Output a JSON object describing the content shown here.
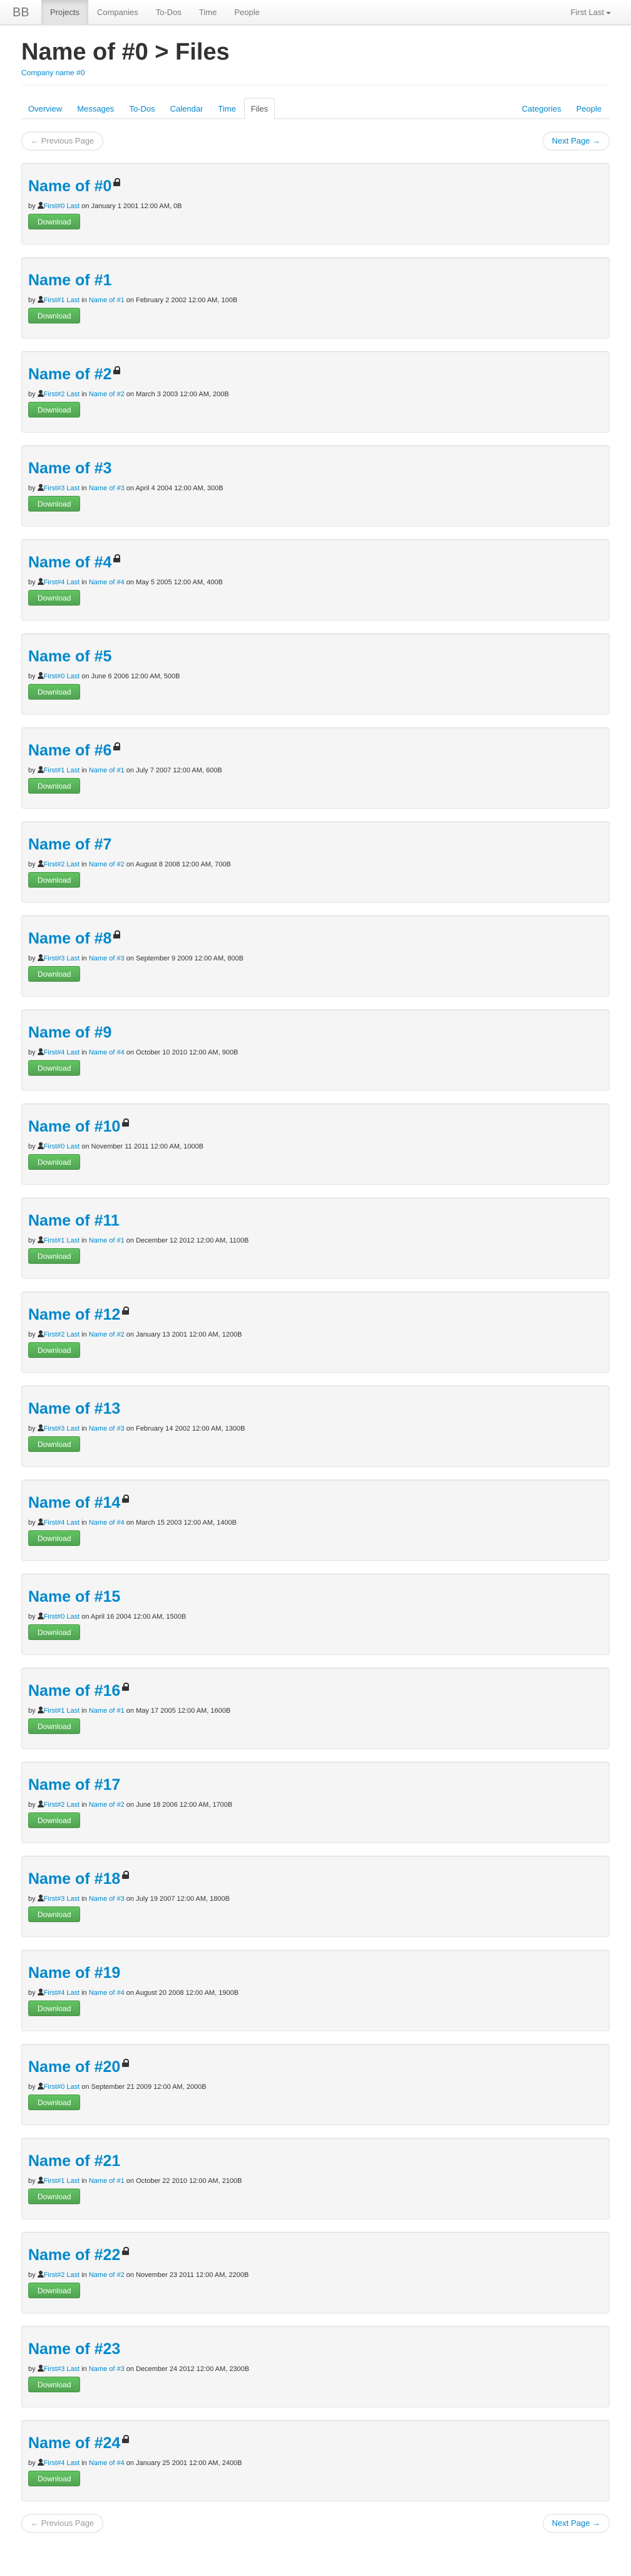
{
  "navbar": {
    "brand": "BB",
    "items": [
      {
        "label": "Projects",
        "active": true
      },
      {
        "label": "Companies",
        "active": false
      },
      {
        "label": "To-Dos",
        "active": false
      },
      {
        "label": "Time",
        "active": false
      },
      {
        "label": "People",
        "active": false
      }
    ],
    "user": "First Last"
  },
  "header": {
    "title": "Name of #0 > Files",
    "company": "Company name #0"
  },
  "tabs": {
    "left": [
      {
        "label": "Overview",
        "active": false
      },
      {
        "label": "Messages",
        "active": false
      },
      {
        "label": "To-Dos",
        "active": false
      },
      {
        "label": "Calendar",
        "active": false
      },
      {
        "label": "Time",
        "active": false
      },
      {
        "label": "Files",
        "active": true
      }
    ],
    "right": [
      {
        "label": "Categories"
      },
      {
        "label": "People"
      }
    ]
  },
  "pager": {
    "prev": "← Previous Page",
    "next": "Next Page →"
  },
  "strings": {
    "by": "by",
    "in": "in",
    "on": "on",
    "download": "Download"
  },
  "files": [
    {
      "name": "Name of #0",
      "locked": true,
      "author": "First#0 Last",
      "project": "",
      "date": "January 1 2001 12:00 AM",
      "size": "0B"
    },
    {
      "name": "Name of #1",
      "locked": false,
      "author": "First#1 Last",
      "project": "Name of #1",
      "date": "February 2 2002 12:00 AM",
      "size": "100B"
    },
    {
      "name": "Name of #2",
      "locked": true,
      "author": "First#2 Last",
      "project": "Name of #2",
      "date": "March 3 2003 12:00 AM",
      "size": "200B"
    },
    {
      "name": "Name of #3",
      "locked": false,
      "author": "First#3 Last",
      "project": "Name of #3",
      "date": "April 4 2004 12:00 AM",
      "size": "300B"
    },
    {
      "name": "Name of #4",
      "locked": true,
      "author": "First#4 Last",
      "project": "Name of #4",
      "date": "May 5 2005 12:00 AM",
      "size": "400B"
    },
    {
      "name": "Name of #5",
      "locked": false,
      "author": "First#0 Last",
      "project": "",
      "date": "June 6 2006 12:00 AM",
      "size": "500B"
    },
    {
      "name": "Name of #6",
      "locked": true,
      "author": "First#1 Last",
      "project": "Name of #1",
      "date": "July 7 2007 12:00 AM",
      "size": "600B"
    },
    {
      "name": "Name of #7",
      "locked": false,
      "author": "First#2 Last",
      "project": "Name of #2",
      "date": "August 8 2008 12:00 AM",
      "size": "700B"
    },
    {
      "name": "Name of #8",
      "locked": true,
      "author": "First#3 Last",
      "project": "Name of #3",
      "date": "September 9 2009 12:00 AM",
      "size": "800B"
    },
    {
      "name": "Name of #9",
      "locked": false,
      "author": "First#4 Last",
      "project": "Name of #4",
      "date": "October 10 2010 12:00 AM",
      "size": "900B"
    },
    {
      "name": "Name of #10",
      "locked": true,
      "author": "First#0 Last",
      "project": "",
      "date": "November 11 2011 12:00 AM",
      "size": "1000B"
    },
    {
      "name": "Name of #11",
      "locked": false,
      "author": "First#1 Last",
      "project": "Name of #1",
      "date": "December 12 2012 12:00 AM",
      "size": "1100B"
    },
    {
      "name": "Name of #12",
      "locked": true,
      "author": "First#2 Last",
      "project": "Name of #2",
      "date": "January 13 2001 12:00 AM",
      "size": "1200B"
    },
    {
      "name": "Name of #13",
      "locked": false,
      "author": "First#3 Last",
      "project": "Name of #3",
      "date": "February 14 2002 12:00 AM",
      "size": "1300B"
    },
    {
      "name": "Name of #14",
      "locked": true,
      "author": "First#4 Last",
      "project": "Name of #4",
      "date": "March 15 2003 12:00 AM",
      "size": "1400B"
    },
    {
      "name": "Name of #15",
      "locked": false,
      "author": "First#0 Last",
      "project": "",
      "date": "April 16 2004 12:00 AM",
      "size": "1500B"
    },
    {
      "name": "Name of #16",
      "locked": true,
      "author": "First#1 Last",
      "project": "Name of #1",
      "date": "May 17 2005 12:00 AM",
      "size": "1600B"
    },
    {
      "name": "Name of #17",
      "locked": false,
      "author": "First#2 Last",
      "project": "Name of #2",
      "date": "June 18 2006 12:00 AM",
      "size": "1700B"
    },
    {
      "name": "Name of #18",
      "locked": true,
      "author": "First#3 Last",
      "project": "Name of #3",
      "date": "July 19 2007 12:00 AM",
      "size": "1800B"
    },
    {
      "name": "Name of #19",
      "locked": false,
      "author": "First#4 Last",
      "project": "Name of #4",
      "date": "August 20 2008 12:00 AM",
      "size": "1900B"
    },
    {
      "name": "Name of #20",
      "locked": true,
      "author": "First#0 Last",
      "project": "",
      "date": "September 21 2009 12:00 AM",
      "size": "2000B"
    },
    {
      "name": "Name of #21",
      "locked": false,
      "author": "First#1 Last",
      "project": "Name of #1",
      "date": "October 22 2010 12:00 AM",
      "size": "2100B"
    },
    {
      "name": "Name of #22",
      "locked": true,
      "author": "First#2 Last",
      "project": "Name of #2",
      "date": "November 23 2011 12:00 AM",
      "size": "2200B"
    },
    {
      "name": "Name of #23",
      "locked": false,
      "author": "First#3 Last",
      "project": "Name of #3",
      "date": "December 24 2012 12:00 AM",
      "size": "2300B"
    },
    {
      "name": "Name of #24",
      "locked": true,
      "author": "First#4 Last",
      "project": "Name of #4",
      "date": "January 25 2001 12:00 AM",
      "size": "2400B"
    }
  ]
}
